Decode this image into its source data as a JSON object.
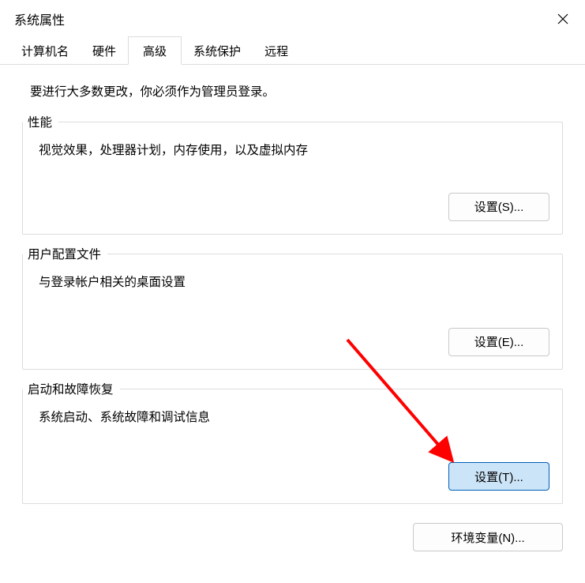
{
  "window": {
    "title": "系统属性"
  },
  "tabs": [
    {
      "label": "计算机名",
      "active": false
    },
    {
      "label": "硬件",
      "active": false
    },
    {
      "label": "高级",
      "active": true
    },
    {
      "label": "系统保护",
      "active": false
    },
    {
      "label": "远程",
      "active": false
    }
  ],
  "instruction": "要进行大多数更改，你必须作为管理员登录。",
  "groups": {
    "performance": {
      "legend": "性能",
      "desc": "视觉效果，处理器计划，内存使用，以及虚拟内存",
      "button": "设置(S)..."
    },
    "userprofile": {
      "legend": "用户配置文件",
      "desc": "与登录帐户相关的桌面设置",
      "button": "设置(E)..."
    },
    "startup": {
      "legend": "启动和故障恢复",
      "desc": "系统启动、系统故障和调试信息",
      "button": "设置(T)..."
    }
  },
  "env_button": "环境变量(N)..."
}
